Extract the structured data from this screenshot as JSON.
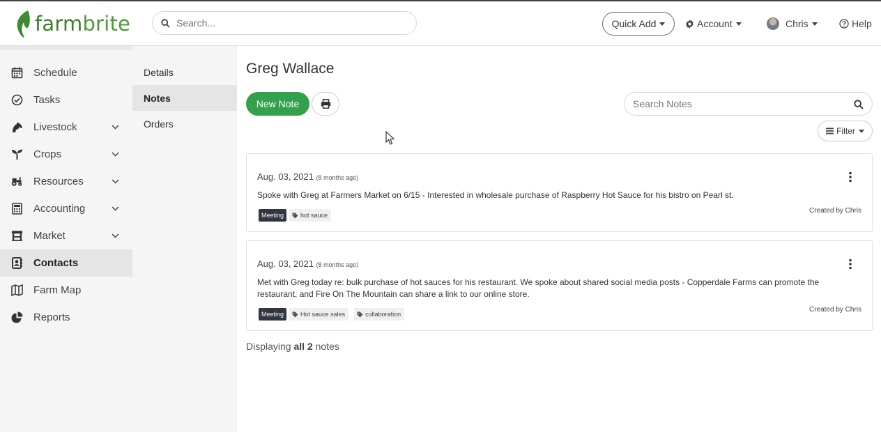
{
  "header": {
    "logo_text_a": "farm",
    "logo_text_b": "brite",
    "search_placeholder": "Search...",
    "quick_add_label": "Quick Add",
    "account_label": "Account",
    "user_label": "Chris",
    "help_label": "Help"
  },
  "sidebar": {
    "items": [
      {
        "label": "Schedule",
        "icon": "calendar-icon"
      },
      {
        "label": "Tasks",
        "icon": "check-circle-icon"
      },
      {
        "label": "Livestock",
        "icon": "horse-icon"
      },
      {
        "label": "Crops",
        "icon": "seedling-icon"
      },
      {
        "label": "Resources",
        "icon": "tractor-icon"
      },
      {
        "label": "Accounting",
        "icon": "calculator-icon"
      },
      {
        "label": "Market",
        "icon": "store-icon"
      },
      {
        "label": "Contacts",
        "icon": "address-book-icon"
      },
      {
        "label": "Farm Map",
        "icon": "map-icon"
      },
      {
        "label": "Reports",
        "icon": "pie-chart-icon"
      }
    ],
    "active": "Contacts"
  },
  "subnav": {
    "items": [
      "Details",
      "Notes",
      "Orders"
    ],
    "active": "Notes"
  },
  "main": {
    "title": "Greg Wallace",
    "new_note_label": "New Note",
    "search_notes_placeholder": "Search Notes",
    "filter_label": "Filter",
    "notes": [
      {
        "date": "Aug. 03, 2021",
        "ago": "(8 months ago)",
        "body": "Spoke with Greg at Farmers Market on 6/15 - Interested in wholesale purchase of Raspberry Hot Sauce for his bistro on Pearl st.",
        "category": "Meeting",
        "tags": [
          "hot sauce"
        ],
        "created_by": "Created by Chris"
      },
      {
        "date": "Aug. 03, 2021",
        "ago": "(8 months ago)",
        "body": "Met with Greg today re: bulk purchase of hot sauces for his restaurant. We spoke about shared social media posts - Copperdale Farms can promote the restaurant, and Fire On The Mountain can share a link to our online store.",
        "category": "Meeting",
        "tags": [
          "Hot sauce sales",
          "collaboration"
        ],
        "created_by": "Created by Chris"
      }
    ],
    "footer_prefix": "Displaying",
    "footer_count": "all 2",
    "footer_suffix": "notes"
  },
  "colors": {
    "brand_green": "#33a04b",
    "logo_green": "#3d7d2e",
    "badge_dark": "#2f3640"
  }
}
